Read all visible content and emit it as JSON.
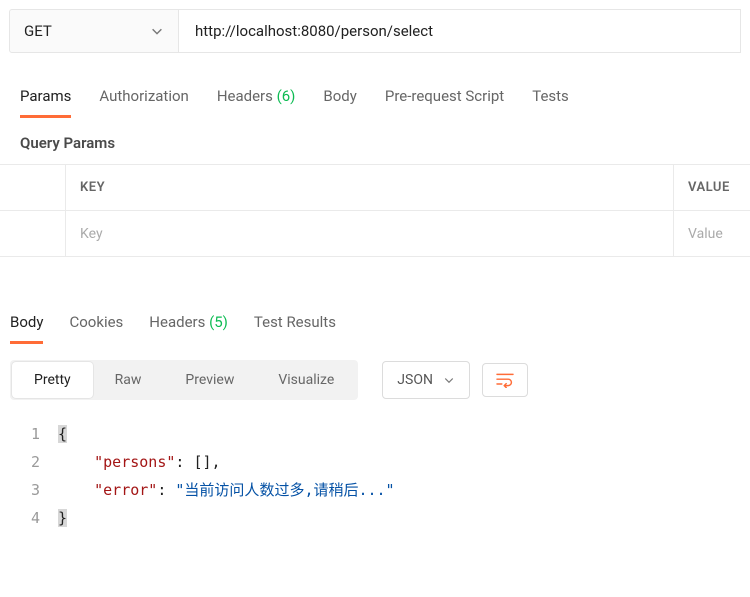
{
  "request": {
    "method": "GET",
    "url": "http://localhost:8080/person/select"
  },
  "request_tabs": {
    "params": "Params",
    "authorization": "Authorization",
    "headers_label": "Headers",
    "headers_count": "(6)",
    "body": "Body",
    "prerequest": "Pre-request Script",
    "tests": "Tests"
  },
  "query_params": {
    "title": "Query Params",
    "key_header": "KEY",
    "value_header": "VALUE",
    "key_placeholder": "Key",
    "value_placeholder": "Value"
  },
  "response_tabs": {
    "body": "Body",
    "cookies": "Cookies",
    "headers_label": "Headers",
    "headers_count": "(5)",
    "test_results": "Test Results"
  },
  "body_toolbar": {
    "pretty": "Pretty",
    "raw": "Raw",
    "preview": "Preview",
    "visualize": "Visualize",
    "format": "JSON"
  },
  "response_code": {
    "l1a": "{",
    "l2_key": "\"persons\"",
    "l2_colon": ": ",
    "l2_val": "[]",
    "l2_comma": ",",
    "l3_key": "\"error\"",
    "l3_colon": ": ",
    "l3_val": "\"当前访问人数过多,请稍后...\"",
    "l4a": "}",
    "ln1": "1",
    "ln2": "2",
    "ln3": "3",
    "ln4": "4"
  }
}
